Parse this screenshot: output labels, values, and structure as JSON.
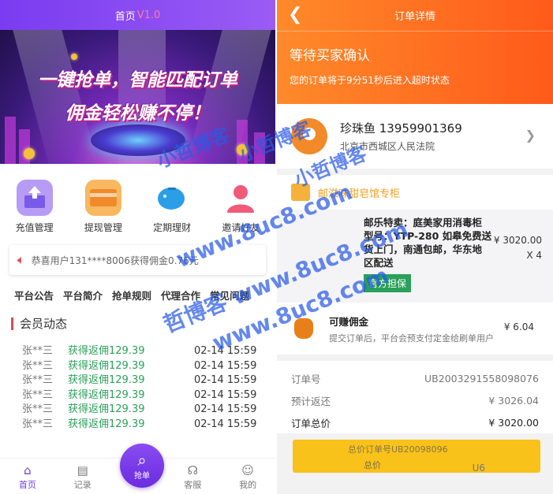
{
  "left": {
    "header": {
      "title": "首页",
      "version": "V1.0"
    },
    "banner": {
      "line1": "一键抢单，智能匹配订单",
      "line2": "佣金轻松赚不停！"
    },
    "quick": [
      {
        "label": "充值管理",
        "icon": "wallet-upload-icon",
        "color": "#a88cf4"
      },
      {
        "label": "提现管理",
        "icon": "card-icon",
        "color": "#f6a14a"
      },
      {
        "label": "定期理财",
        "icon": "piggy-bank-icon",
        "color": "#2aa7ee"
      },
      {
        "label": "邀请好友",
        "icon": "user-invite-icon",
        "color": "#f25a7a"
      }
    ],
    "notice": "恭喜用户131****8006获得佣金0.76元",
    "tabs": [
      "平台公告",
      "平台简介",
      "抢单规则",
      "代理合作",
      "常见问题"
    ],
    "member_title": "会员动态",
    "feed": [
      {
        "user": "张**三",
        "gain": "获得返佣129.39",
        "time": "02-14 15:59"
      },
      {
        "user": "张**三",
        "gain": "获得返佣129.39",
        "time": "02-14 15:59"
      },
      {
        "user": "张**三",
        "gain": "获得返佣129.39",
        "time": "02-14 15:59"
      },
      {
        "user": "张**三",
        "gain": "获得返佣129.39",
        "time": "02-14 15:59"
      },
      {
        "user": "张**三",
        "gain": "获得返佣129.39",
        "time": "02-14 15:59"
      },
      {
        "user": "张**三",
        "gain": "获得返佣129.39",
        "time": "02-14 15:59"
      }
    ],
    "tabbar": {
      "home": "首页",
      "records": "记录",
      "grab": "抢单",
      "service": "客服",
      "mine": "我的"
    }
  },
  "right": {
    "header": {
      "title": "订单详情",
      "status": "等待买家确认",
      "sub": "您的订单将于9分51秒后进入超时状态"
    },
    "address": {
      "name": "珍珠鱼 13959901369",
      "addr": "北京市西城区人民法院"
    },
    "shop": "邮滋味甜皂馆专柜",
    "product": {
      "line1": "邮乐特卖：庭美家用消毒柜",
      "line2": "型号：YTP-280 如皋免费送",
      "line3": "货上门，南通包邮，华东地",
      "line4": "区配送",
      "price": "¥ 3020.00",
      "qty": "X 4",
      "badge": "官方担保"
    },
    "commission": {
      "title": "可赚佣金",
      "desc": "提交订单后，平台会预支付定金给刷单用户",
      "value": "¥ 6.04"
    },
    "summary": {
      "order_no_label": "订单号",
      "order_no": "UB2003291558098076",
      "rebate_label": "预计返还",
      "rebate": "¥ 3026.04",
      "total_label": "订单总价",
      "total": "¥ 3020.00"
    },
    "ghost": {
      "g1": "总价订单号UB20098096",
      "g2": "总价"
    },
    "u6": "U6"
  },
  "watermark": {
    "brand_a": "小哲博客",
    "brand_b": "小哲博客",
    "brand_c": "小哲博客",
    "url_a": "www.8uc8.com",
    "url_b": "哲博客 www.8uc8.com",
    "url_c": "www.8uc8.com"
  }
}
